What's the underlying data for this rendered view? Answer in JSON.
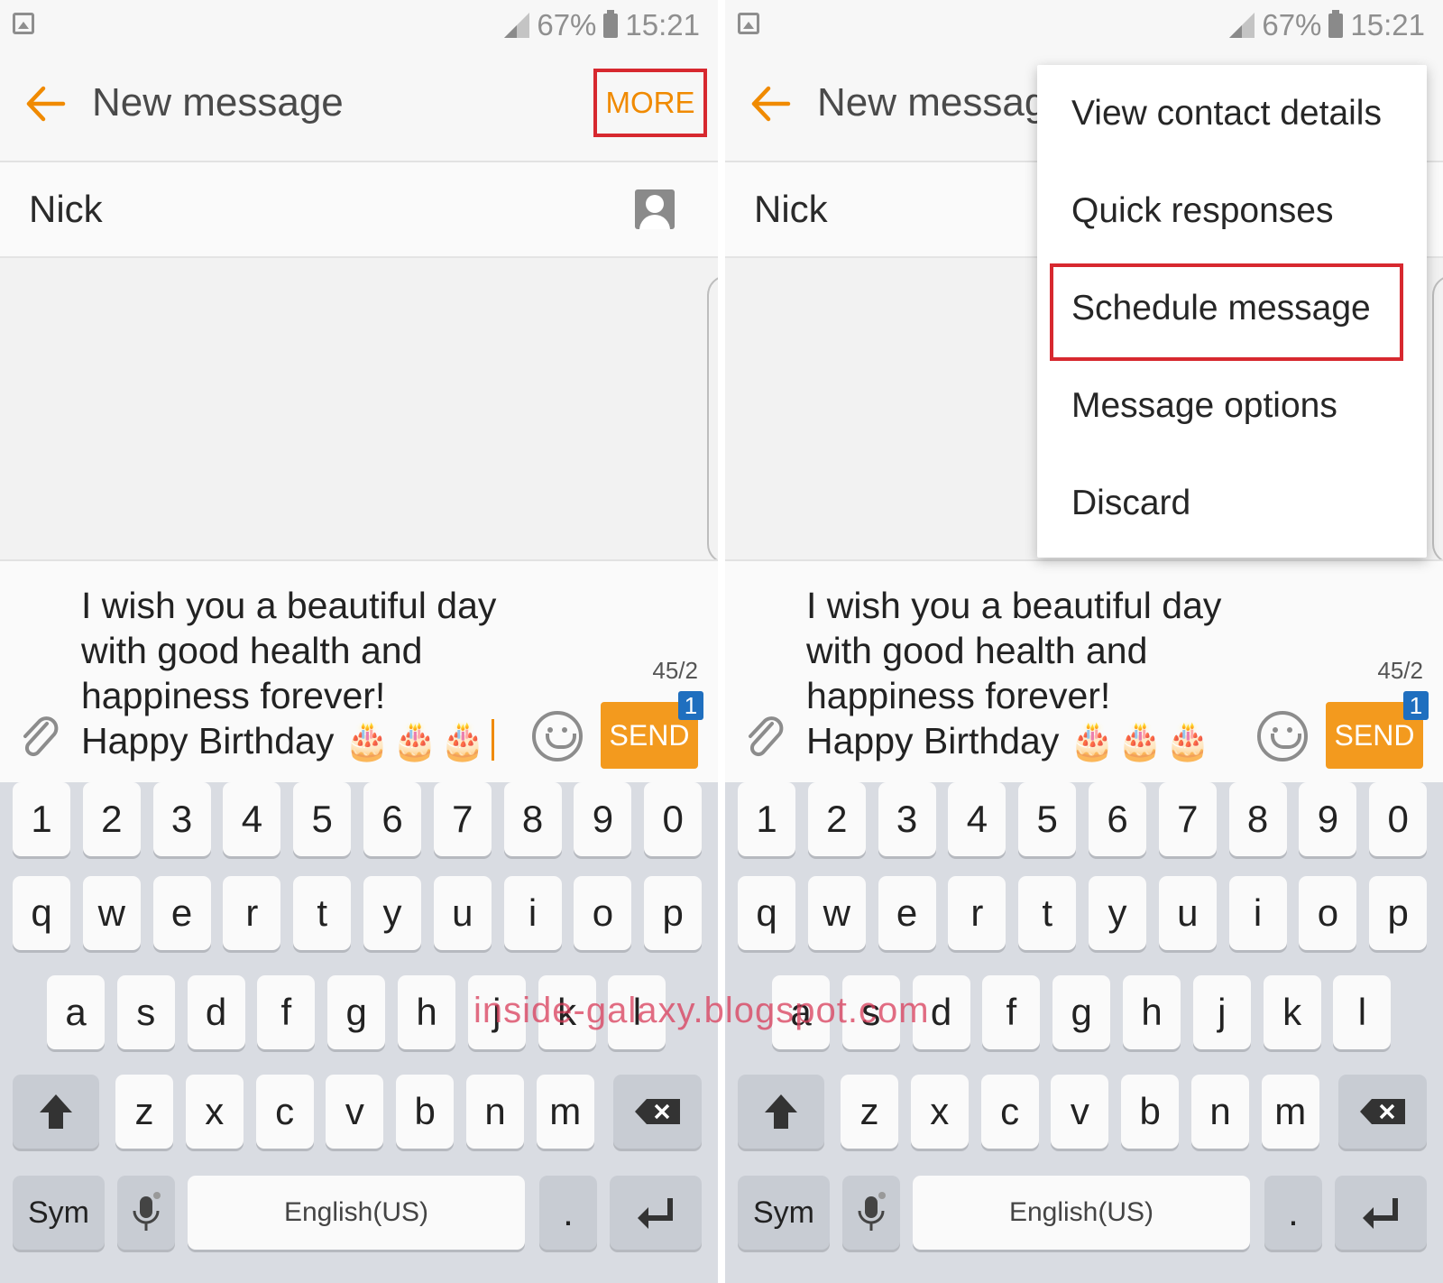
{
  "status": {
    "signal_icon": "signal-icon",
    "battery": "67%",
    "time": "15:21"
  },
  "appbar": {
    "title": "New message",
    "more_label": "MORE"
  },
  "recipient": {
    "name": "Nick"
  },
  "compose": {
    "lines": [
      "I wish you a beautiful day",
      "with good health and",
      "happiness forever!",
      "Happy Birthday"
    ],
    "cakes": "🎂🎂🎂",
    "counter": "45/2",
    "send_label": "SEND",
    "send_badge": "1"
  },
  "keyboard": {
    "numbers": [
      "1",
      "2",
      "3",
      "4",
      "5",
      "6",
      "7",
      "8",
      "9",
      "0"
    ],
    "row1": [
      "q",
      "w",
      "e",
      "r",
      "t",
      "y",
      "u",
      "i",
      "o",
      "p"
    ],
    "row2": [
      "a",
      "s",
      "d",
      "f",
      "g",
      "h",
      "j",
      "k",
      "l"
    ],
    "row3": [
      "z",
      "x",
      "c",
      "v",
      "b",
      "n",
      "m"
    ],
    "sym_label": "Sym",
    "space_label": "English(US)",
    "period_label": "."
  },
  "menu": {
    "items": [
      "View contact details",
      "Quick responses",
      "Schedule message",
      "Message options",
      "Discard"
    ],
    "highlighted": "Schedule message"
  },
  "watermark": "inside-galaxy.blogspot.com",
  "colors": {
    "accent": "#f08a00",
    "send": "#f39a1e",
    "highlight": "#d7282f",
    "badge": "#1f6fbf"
  }
}
